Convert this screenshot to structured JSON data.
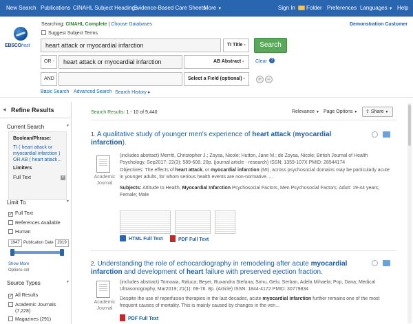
{
  "topnav": {
    "left": [
      "New Search",
      "Publications",
      "CINAHL Subject Headings",
      "Evidence-Based Care Sheets",
      "More"
    ],
    "right": [
      "Sign In",
      "Folder",
      "Preferences",
      "Languages",
      "Help"
    ]
  },
  "logo": {
    "word_bold": "EBSCO",
    "word_italic": "host"
  },
  "header": {
    "searching_label": "Searching:",
    "database": "CINAHL Complete",
    "choose_db": "Choose Databases",
    "suggest": "Suggest Subject Terms",
    "demo_customer": "Demonstration Customer"
  },
  "search": {
    "row1_value": "heart attack or myocardial infarction",
    "row1_field": "TI Title -",
    "row2_op": "OR -",
    "row2_value": "heart attack or myocardial infarction",
    "row2_field": "AB Abstract -",
    "row3_op": "AND -",
    "row3_value": "",
    "row3_field": "Select a Field (optional) -",
    "search_button": "Search",
    "clear": "Clear",
    "help": "?"
  },
  "header_links": [
    "Basic Search",
    "Advanced Search",
    "Search History"
  ],
  "sidebar": {
    "refine": "Refine Results",
    "current_search": "Current Search",
    "boolean_label": "Boolean/Phrase:",
    "boolean_value": "TI ( heart attack or myocardial infarction ) OR AB ( heart attack...",
    "limiters_label": "Limiters",
    "limiter_value": "Full Text",
    "limit_to": "Limit To",
    "limits": [
      "Full Text",
      "References Available",
      "Human"
    ],
    "year_from": "1947",
    "year_label": "Publication Date",
    "year_to": "2019",
    "show_more": "Show More",
    "options_set": "Options set",
    "source_types": "Source Types",
    "sources": [
      "All Results",
      "Academic Journals (7,228)",
      "Magazines (291)"
    ]
  },
  "results_bar": {
    "label": "Search Results:",
    "range": "1 - 10 of 9,440",
    "relevance": "Relevance",
    "page_options": "Page Options",
    "share": "Share"
  },
  "results": [
    {
      "num": "1.",
      "title_parts": [
        "A qualitative study of younger men's experience of ",
        "heart attack",
        " (",
        "myocardial infarction",
        ")."
      ],
      "doc_type": "Academic Journal",
      "citation": "(includes abstract) Merritt, Christopher J.; Zoysa, Nicole; Hutton, Jane M.; de Zoysa, Nicole; British Journal of Health Psychology, Sep2017; 22(3): 589-608. 20p. (journal article - research) ISSN: 1359-107X PMID: 28544174",
      "abstract_parts": [
        "Objectives: The effects of ",
        "heart attack",
        ", or ",
        "myocardial infarction",
        " (MI), across psychosocial domains may be particularly acute in younger adults, for whom serious health events are non-normative. ..."
      ],
      "subjects_label": "Subjects:",
      "subjects_parts": [
        " Attitude to Health, ",
        "Myocardial Infarction",
        " Psychosocial Factors, Men Psychosocial Factors; Adult: 19-44 years; Female; Male"
      ],
      "links": [
        "HTML Full Text",
        "PDF Full Text"
      ]
    },
    {
      "num": "2.",
      "title_parts": [
        "Understanding the role of echocardiography in remodeling after acute ",
        "myocardial infarction",
        " and development of ",
        "heart",
        " failure with preserved ejection fraction."
      ],
      "doc_type": "Academic Journal",
      "citation": "(includes abstract) Tomoaia, Raluca; Beyer, Ruxandra Stefana; Simu, Gelu; Serban, Adela Mihaela; Pop, Dana; Medical Ultrasonography, Mar2019; 21(1): 69-76. 8p. (Article) ISSN: 1844-4172 PMID: 30779834",
      "abstract_parts": [
        "Despite the use of reperfusion therapies in the last decades, acute ",
        "myocardial infarction",
        " further remains one of the most frequent causes of mortality. This is mainly caused by changes in the ven..."
      ],
      "links": [
        "PDF Full Text"
      ]
    }
  ]
}
